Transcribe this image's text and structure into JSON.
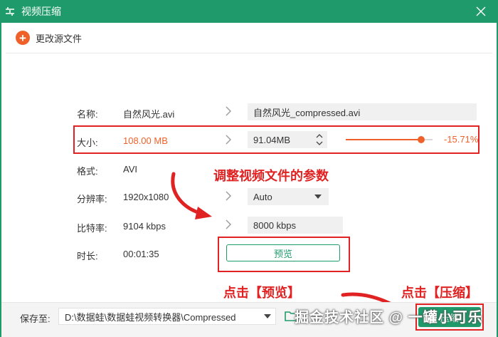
{
  "window": {
    "title": "视频压缩"
  },
  "toolbar": {
    "change_source_label": "更改源文件"
  },
  "rows": {
    "name": {
      "label": "名称:",
      "value": "自然风光.avi",
      "output": "自然风光_compressed.avi"
    },
    "size": {
      "label": "大小:",
      "value": "108.00 MB",
      "output": "91.04MB",
      "ratio": 0.87,
      "percent": "-15.71%"
    },
    "format": {
      "label": "格式:",
      "value": "AVI"
    },
    "resolution": {
      "label": "分辨率:",
      "value": "1920x1080",
      "output": "Auto"
    },
    "bitrate": {
      "label": "比特率:",
      "value": "9104 kbps",
      "output": "8000 kbps"
    },
    "duration": {
      "label": "时长:",
      "value": "00:01:35"
    }
  },
  "preview_label": "预览",
  "annotations": {
    "params": "调整视频文件的参数",
    "click_preview": "点击【预览】",
    "click_compress": "点击【压缩】"
  },
  "bottom": {
    "save_label": "保存至:",
    "path": "D:\\数据蛙\\数据蛙视频转换器\\Compressed",
    "compress_label": "压缩"
  },
  "watermark": "掘金技术社区 @ 一罐小可乐",
  "colors": {
    "brand": "#1f9b6b",
    "accent": "#f0612a",
    "annotation": "#e02222"
  }
}
